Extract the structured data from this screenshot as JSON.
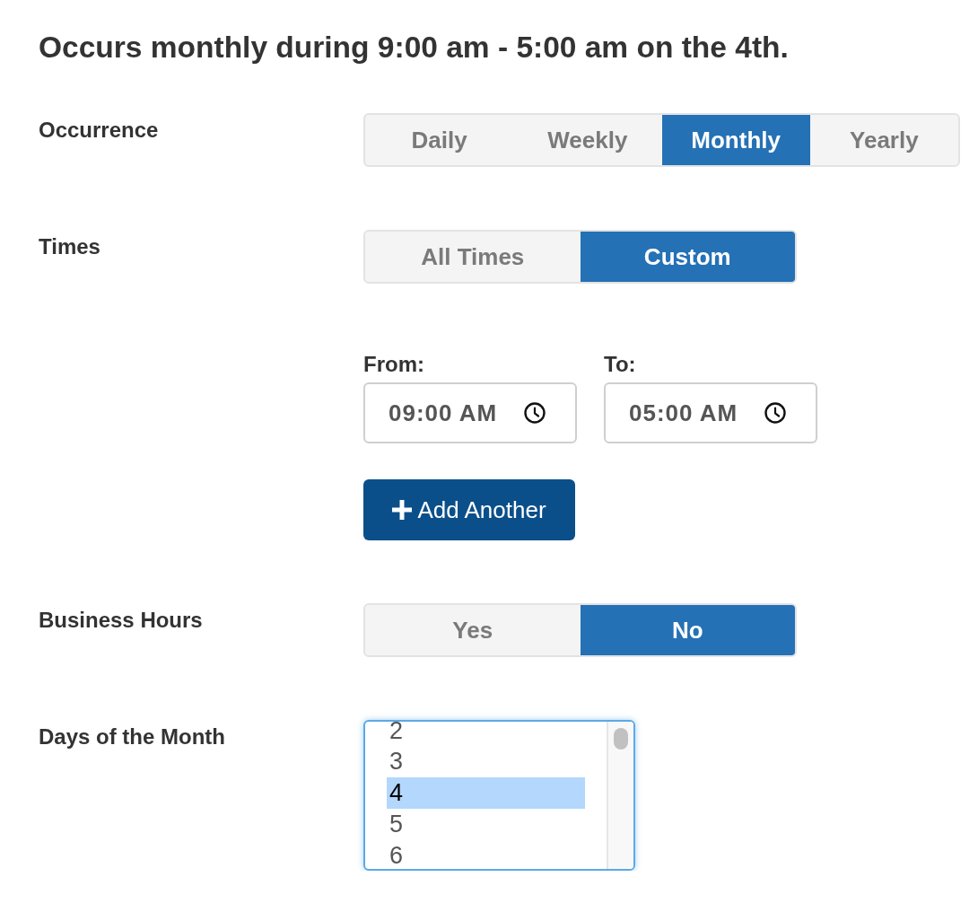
{
  "summary": "Occurs monthly during 9:00 am - 5:00 am on the 4th.",
  "fields": [
    {
      "kind": "segmented",
      "label": "Occurrence",
      "options": [
        {
          "label": "Daily",
          "selected": false
        },
        {
          "label": "Weekly",
          "selected": false
        },
        {
          "label": "Monthly",
          "selected": true
        },
        {
          "label": "Yearly",
          "selected": false
        }
      ]
    },
    {
      "kind": "segmented",
      "label": "Times",
      "options": [
        {
          "label": "All Times",
          "selected": false
        },
        {
          "label": "Custom",
          "selected": true
        }
      ]
    },
    {
      "kind": "time_range",
      "from": {
        "label": "From:",
        "value": "09:00 AM"
      },
      "to": {
        "label": "To:",
        "value": "05:00 AM"
      },
      "add_button": "Add Another"
    },
    {
      "kind": "segmented",
      "label": "Business Hours",
      "options": [
        {
          "label": "Yes",
          "selected": false
        },
        {
          "label": "No",
          "selected": true
        }
      ]
    },
    {
      "kind": "listbox",
      "label": "Days of the Month",
      "options": [
        {
          "label": "2",
          "selected": false
        },
        {
          "label": "3",
          "selected": false
        },
        {
          "label": "4",
          "selected": true
        },
        {
          "label": "5",
          "selected": false
        },
        {
          "label": "6",
          "selected": false
        }
      ]
    }
  ]
}
